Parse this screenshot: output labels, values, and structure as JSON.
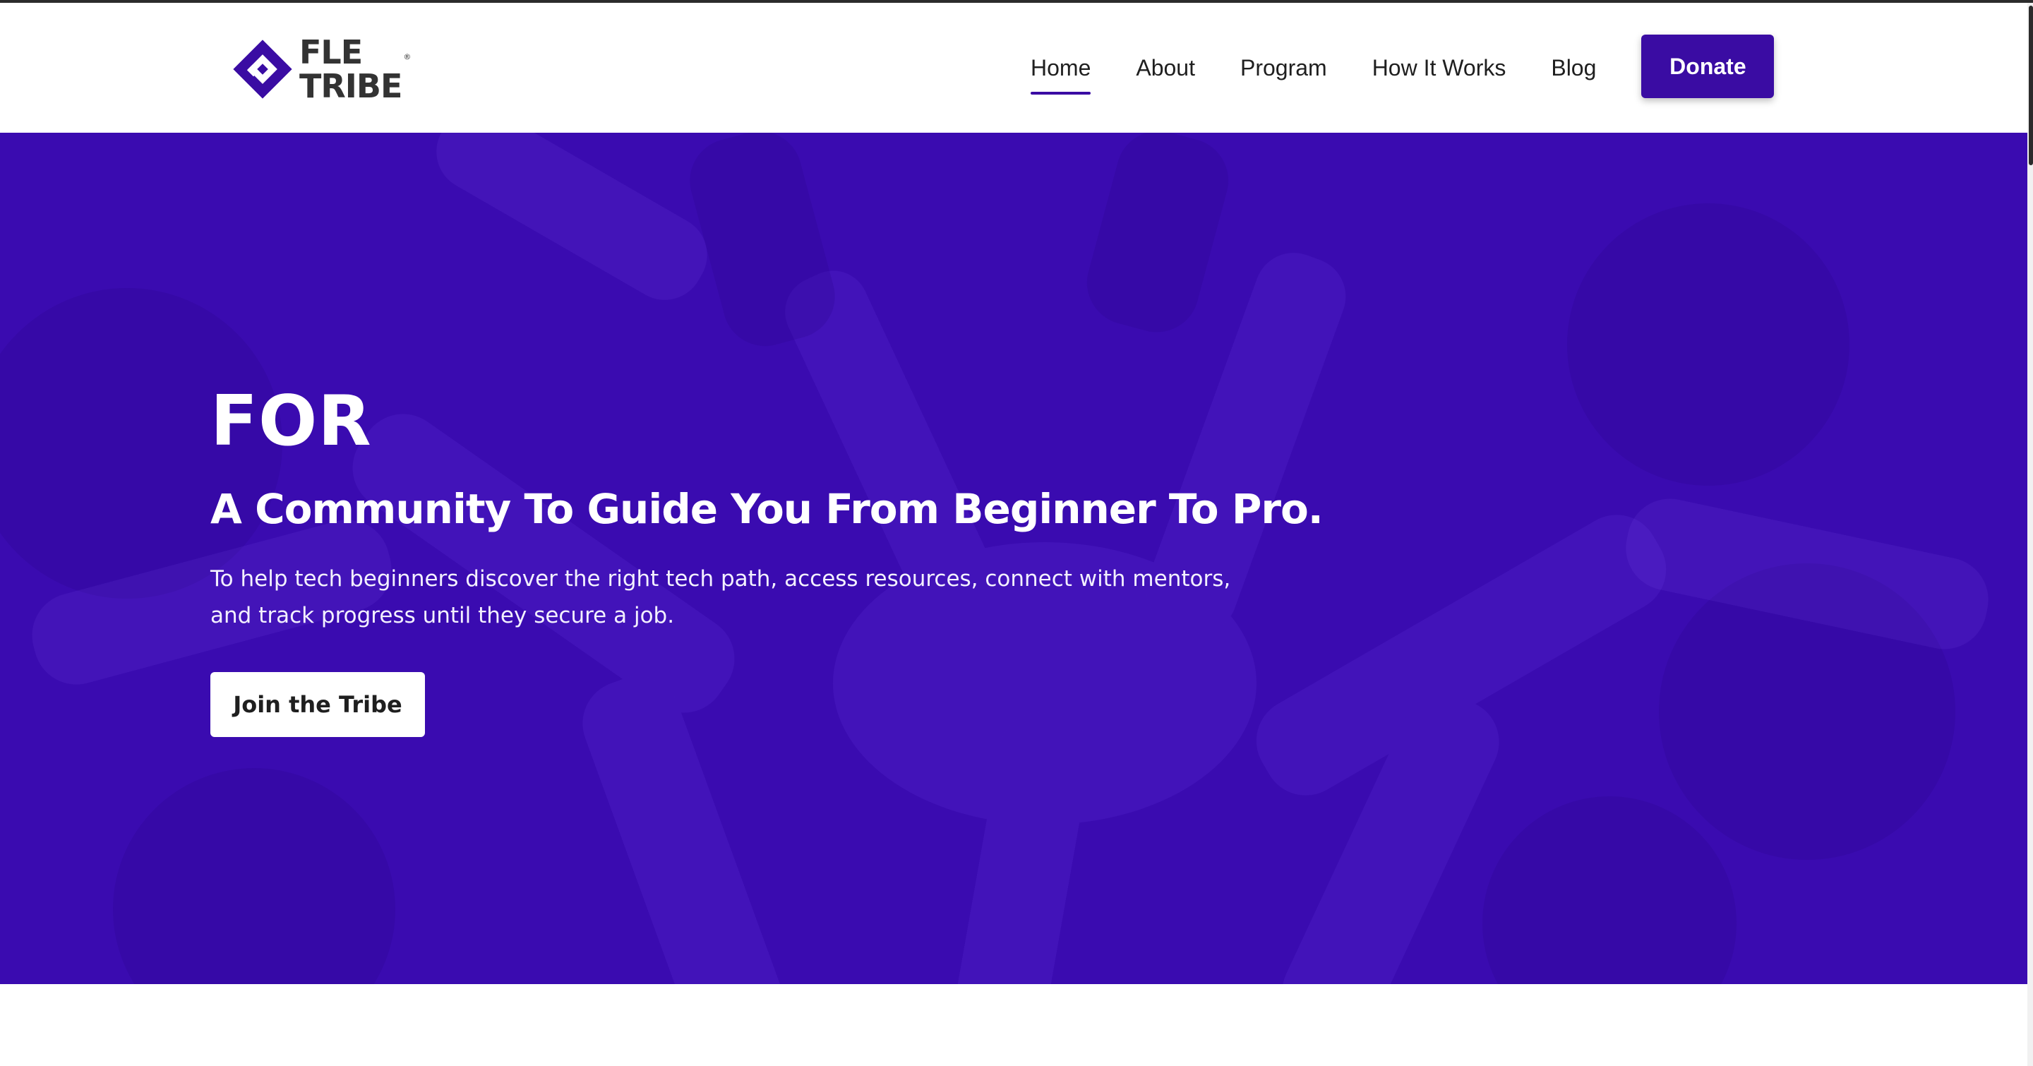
{
  "brand": {
    "line1": "FLE",
    "line2": "TRIBE",
    "registered_mark": "®",
    "accent_color": "#3a0ca3"
  },
  "nav": {
    "items": [
      {
        "label": "Home",
        "active": true
      },
      {
        "label": "About",
        "active": false
      },
      {
        "label": "Program",
        "active": false
      },
      {
        "label": "How It Works",
        "active": false
      },
      {
        "label": "Blog",
        "active": false
      }
    ],
    "donate_label": "Donate"
  },
  "hero": {
    "eyebrow": "FOR",
    "title": "A Community To Guide You From Beginner To Pro.",
    "description": "To  help tech beginners discover the right tech path, access resources, connect with mentors, and track progress until they secure a job.",
    "cta_label": "Join the Tribe",
    "background_color": "#3a0bb0"
  }
}
